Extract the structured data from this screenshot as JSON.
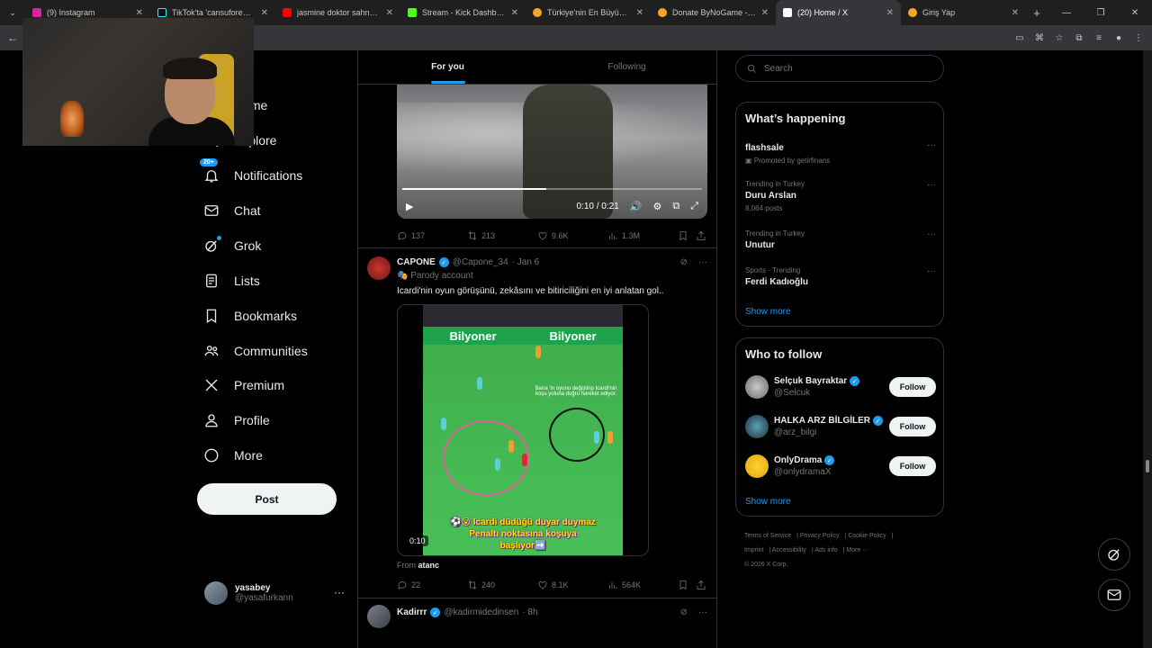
{
  "browser": {
    "tabs": [
      {
        "title": "(9) Instagram",
        "color": "#d6249f"
      },
      {
        "title": "TikTok'ta 'cansuforeal' bu",
        "color": "#111111"
      },
      {
        "title": "jasmine doktor sahne - Yo",
        "color": "#ff0000"
      },
      {
        "title": "Stream - Kick Dashboard",
        "color": "#53fc18"
      },
      {
        "title": "Türkiye'nin En Büyük Oyu",
        "color": "#f5a623"
      },
      {
        "title": "Donate ByNoGame - Gele",
        "color": "#f5a623"
      },
      {
        "title": "(20) Home / X",
        "color": "#ffffff"
      },
      {
        "title": "Giriş Yap",
        "color": "#f5a623"
      }
    ],
    "active_tab": 6
  },
  "nav": {
    "home": "Home",
    "explore": "Explore",
    "notifications": "Notifications",
    "notifications_badge": "20+",
    "chat": "Chat",
    "grok": "Grok",
    "lists": "Lists",
    "bookmarks": "Bookmarks",
    "communities": "Communities",
    "premium": "Premium",
    "profile": "Profile",
    "more": "More",
    "post": "Post"
  },
  "account": {
    "name": "yasabey",
    "handle": "@yasafurkann"
  },
  "feed": {
    "tab_for_you": "For you",
    "tab_following": "Following",
    "video1": {
      "time": "0:10 / 0:21",
      "progress": 0.48,
      "replies": "137",
      "reposts": "213",
      "likes": "9.6K",
      "views": "1.3M"
    },
    "tweet2": {
      "name": "CAPONE",
      "handle": "@Capone_34",
      "date": "· Jan 6",
      "parody": "Parody account",
      "text": "Icardi'nin oyun görüşünü, zekâsını ve bitiriciliğini en iyi anlatan gol..",
      "billboard": "Bilyoner",
      "overlay": "Bana 'in oyunu değiştirip Icardi'nin koşu yoluna doğru hareket ediyor.",
      "caption_line1": "⚽😮 Icardi düdüğü duyar duymaz",
      "caption_line2": "Penaltı noktasına koşuya",
      "caption_line3": "başlıyor➡️",
      "time": "0:10",
      "from_label": "From",
      "from_user": "atanc",
      "replies": "22",
      "reposts": "240",
      "likes": "8.1K",
      "views": "564K"
    },
    "tweet3": {
      "name": "Kadirrr",
      "handle": "@kadirmidedinsen",
      "date": "· 8h"
    }
  },
  "search": {
    "placeholder": "Search"
  },
  "happening": {
    "title": "What’s happening",
    "trends": [
      {
        "meta": "",
        "topic": "flashsale",
        "sub": "Promoted by getirfinans"
      },
      {
        "meta": "Trending in Turkey",
        "topic": "Duru Arslan",
        "sub": "8,064 posts"
      },
      {
        "meta": "Trending in Turkey",
        "topic": "Unutur",
        "sub": ""
      },
      {
        "meta": "Sports · Trending",
        "topic": "Ferdi Kadıoğlu",
        "sub": ""
      }
    ],
    "show_more": "Show more"
  },
  "who_to_follow": {
    "title": "Who to follow",
    "users": [
      {
        "name": "Selçuk Bayraktar",
        "handle": "@Selcuk"
      },
      {
        "name": "HALKA ARZ BİLGİLER",
        "handle": "@arz_bilgi"
      },
      {
        "name": "OnlyDrama",
        "handle": "@onlydramaX"
      }
    ],
    "follow_label": "Follow",
    "show_more": "Show more"
  },
  "footer": {
    "links": [
      "Terms of Service",
      "Privacy Policy",
      "Cookie Policy",
      "Imprint",
      "Accessibility",
      "Ads info",
      "More ···"
    ],
    "copyright": "© 2026 X Corp."
  }
}
